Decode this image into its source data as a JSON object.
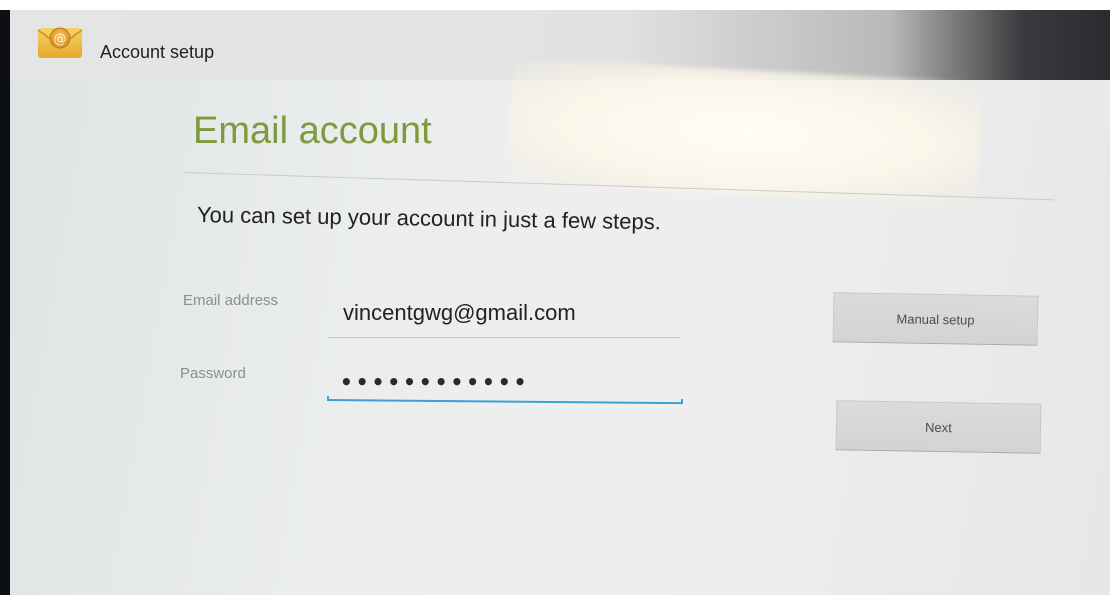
{
  "app": {
    "title": "Account setup",
    "icon": "email-app-icon"
  },
  "page": {
    "title": "Email account",
    "description": "You can set up your account in just a few steps."
  },
  "form": {
    "email": {
      "label": "Email address",
      "value": "vincentgwg@gmail.com"
    },
    "password": {
      "label": "Password",
      "value": "••••••••••••"
    }
  },
  "buttons": {
    "manual_setup": "Manual setup",
    "next": "Next"
  },
  "colors": {
    "accent_title": "#7d9a3c",
    "focus_underline": "#3aa0d6"
  }
}
